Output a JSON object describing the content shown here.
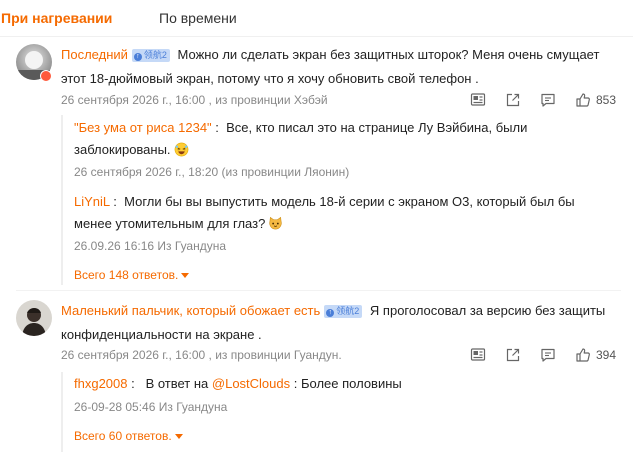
{
  "tabs": {
    "hot": "При нагревании",
    "time": "По времени"
  },
  "colors": {
    "accent": "#f56a00",
    "meta": "#888888",
    "badge_bg": "#c5d9f7",
    "badge_fg": "#4a7ed8"
  },
  "comments": [
    {
      "username": "Последний",
      "badge": "领航2",
      "text": "Можно ли сделать экран без защитных шторок? Меня очень смущает этот 18-дюймовый экран, потому что я хочу обновить свой телефон .",
      "meta": "26 сентября 2026 г., 16:00 , из провинции Хэбэй",
      "likes": "853",
      "replies": [
        {
          "user": "\"Без ума от риса 1234\"",
          "sep": " :  ",
          "text": "Все, кто писал это на странице Лу Вэйбина, были заблокированы.",
          "emoji": "laughing-emoji",
          "meta": "26 сентября 2026 г., 18:20 (из провинции Ляонин)"
        },
        {
          "user": "LiYniL",
          "sep": " :  ",
          "text": "Могли бы вы выпустить модель 18-й серии с экраном O3, который был бы менее утомительным для глаз?",
          "emoji": "cat-emoji",
          "meta": "26.09.26 16:16 Из Гуандуна"
        }
      ],
      "more_replies": "Всего 148 ответов."
    },
    {
      "username": "Маленький пальчик, который обожает есть",
      "badge": "领航2",
      "text": "Я проголосовал за версию без защиты конфиденциальности на экране .",
      "meta": "26 сентября 2026 г., 16:00 , из провинции Гуандун.",
      "likes": "394",
      "replies": [
        {
          "user": "fhxg2008",
          "sep": " :   ",
          "reply_prefix": "В ответ на ",
          "mention": "@LostClouds",
          "text": " : Более половины",
          "meta": "26-09-28 05:46 Из Гуандуна"
        }
      ],
      "more_replies": "Всего 60 ответов."
    }
  ],
  "icons": {
    "translate": "translate-icon",
    "share": "share-icon",
    "comment": "comment-icon",
    "like": "thumbs-up-icon"
  }
}
